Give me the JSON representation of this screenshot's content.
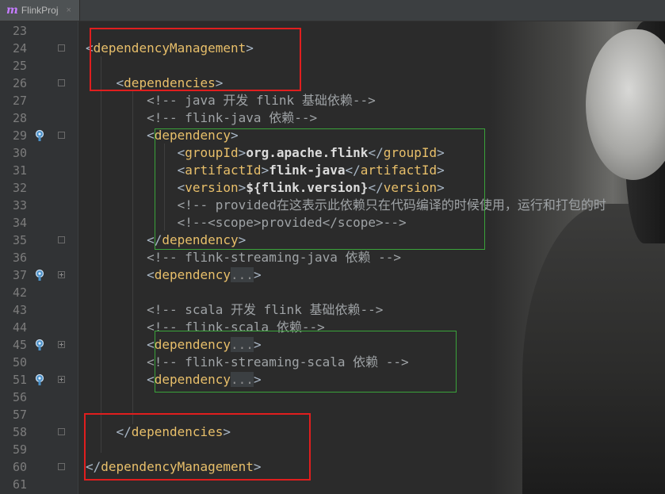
{
  "tab": {
    "icon": "m",
    "label": "FlinkProj",
    "close": "×"
  },
  "lines": [
    {
      "n": "23",
      "parts": []
    },
    {
      "n": "24",
      "fold": "open",
      "parts": [
        [
          "b",
          "<"
        ],
        [
          "t",
          "dependencyManagement"
        ],
        [
          "b",
          ">"
        ]
      ]
    },
    {
      "n": "25",
      "parts": []
    },
    {
      "n": "26",
      "fold": "open",
      "parts": [
        [
          "b",
          "    <"
        ],
        [
          "t",
          "dependencies"
        ],
        [
          "b",
          ">"
        ]
      ]
    },
    {
      "n": "27",
      "parts": [
        [
          "cm",
          "        <!-- java 开发 flink 基础依赖-->"
        ]
      ]
    },
    {
      "n": "28",
      "parts": [
        [
          "cm",
          "        <!-- flink-java 依赖-->"
        ]
      ]
    },
    {
      "n": "29",
      "bulb": true,
      "fold": "open",
      "parts": [
        [
          "b",
          "        <"
        ],
        [
          "t",
          "dependency"
        ],
        [
          "b",
          ">"
        ]
      ]
    },
    {
      "n": "30",
      "parts": [
        [
          "b",
          "            <"
        ],
        [
          "t",
          "groupId"
        ],
        [
          "b",
          ">"
        ],
        [
          "tx",
          "org.apache.flink"
        ],
        [
          "b",
          "</"
        ],
        [
          "t",
          "groupId"
        ],
        [
          "b",
          ">"
        ]
      ]
    },
    {
      "n": "31",
      "parts": [
        [
          "b",
          "            <"
        ],
        [
          "t",
          "artifactId"
        ],
        [
          "b",
          ">"
        ],
        [
          "tx",
          "flink-java"
        ],
        [
          "b",
          "</"
        ],
        [
          "t",
          "artifactId"
        ],
        [
          "b",
          ">"
        ]
      ]
    },
    {
      "n": "32",
      "parts": [
        [
          "b",
          "            <"
        ],
        [
          "t",
          "version"
        ],
        [
          "b",
          ">"
        ],
        [
          "tx",
          "${flink.version}"
        ],
        [
          "b",
          "</"
        ],
        [
          "t",
          "version"
        ],
        [
          "b",
          ">"
        ]
      ]
    },
    {
      "n": "33",
      "parts": [
        [
          "cm",
          "            <!-- provided在这表示此依赖只在代码编译的时候使用，运行和打包的时"
        ]
      ]
    },
    {
      "n": "34",
      "parts": [
        [
          "cm",
          "            <!--<scope>provided</scope>-->"
        ]
      ]
    },
    {
      "n": "35",
      "fold": "close",
      "parts": [
        [
          "b",
          "        </"
        ],
        [
          "t",
          "dependency"
        ],
        [
          "b",
          ">"
        ]
      ]
    },
    {
      "n": "36",
      "parts": [
        [
          "cm",
          "        <!-- flink-streaming-java 依赖 -->"
        ]
      ]
    },
    {
      "n": "37",
      "bulb": true,
      "fold": "plus",
      "parts": [
        [
          "b",
          "        <"
        ],
        [
          "t",
          "dependency"
        ],
        [
          "col",
          "..."
        ],
        [
          "b",
          ">"
        ]
      ]
    },
    {
      "n": "42",
      "parts": []
    },
    {
      "n": "43",
      "parts": [
        [
          "cm",
          "        <!-- scala 开发 flink 基础依赖-->"
        ]
      ]
    },
    {
      "n": "44",
      "parts": [
        [
          "cm",
          "        <!-- flink-scala 依赖-->"
        ]
      ]
    },
    {
      "n": "45",
      "bulb": true,
      "fold": "plus",
      "parts": [
        [
          "b",
          "        <"
        ],
        [
          "t",
          "dependency"
        ],
        [
          "col",
          "..."
        ],
        [
          "b",
          ">"
        ]
      ]
    },
    {
      "n": "50",
      "parts": [
        [
          "cm",
          "        <!-- flink-streaming-scala 依赖 -->"
        ]
      ]
    },
    {
      "n": "51",
      "bulb": true,
      "fold": "plus",
      "parts": [
        [
          "b",
          "        <"
        ],
        [
          "t",
          "dependency"
        ],
        [
          "col",
          "..."
        ],
        [
          "b",
          ">"
        ]
      ]
    },
    {
      "n": "56",
      "parts": []
    },
    {
      "n": "57",
      "parts": []
    },
    {
      "n": "58",
      "fold": "close",
      "parts": [
        [
          "b",
          "    </"
        ],
        [
          "t",
          "dependencies"
        ],
        [
          "b",
          ">"
        ]
      ]
    },
    {
      "n": "59",
      "parts": []
    },
    {
      "n": "60",
      "fold": "close",
      "parts": [
        [
          "b",
          "</"
        ],
        [
          "t",
          "dependencyManagement"
        ],
        [
          "b",
          ">"
        ]
      ]
    },
    {
      "n": "61",
      "parts": []
    }
  ]
}
